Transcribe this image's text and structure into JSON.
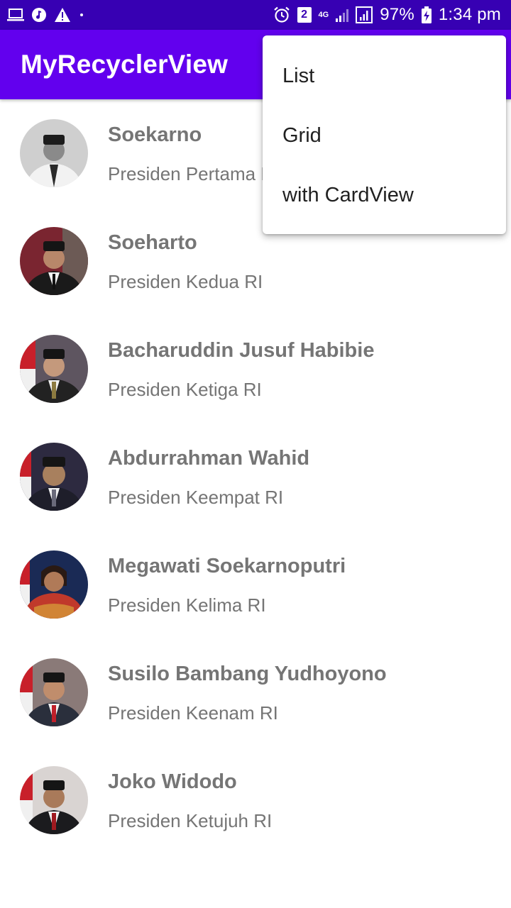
{
  "status_bar": {
    "left_icons": [
      "laptop-icon",
      "music-icon",
      "warning-icon",
      "dot-icon"
    ],
    "right_icons": [
      "alarm-icon",
      "sim-2-icon",
      "4g-data-icon",
      "signal-weak-icon",
      "signal-icon",
      "battery-charging-icon"
    ],
    "sim_label": "2",
    "network_label": "4G",
    "battery": "97%",
    "time": "1:34 pm"
  },
  "app_bar": {
    "title": "MyRecyclerView"
  },
  "menu": {
    "items": [
      {
        "label": "List"
      },
      {
        "label": "Grid"
      },
      {
        "label": "with CardView"
      }
    ]
  },
  "presidents": [
    {
      "name": "Soekarno",
      "description": "Presiden Pertama RI"
    },
    {
      "name": "Soeharto",
      "description": "Presiden Kedua RI"
    },
    {
      "name": "Bacharuddin Jusuf Habibie",
      "description": "Presiden Ketiga RI"
    },
    {
      "name": "Abdurrahman Wahid",
      "description": "Presiden Keempat RI"
    },
    {
      "name": "Megawati Soekarnoputri",
      "description": "Presiden Kelima RI"
    },
    {
      "name": "Susilo Bambang Yudhoyono",
      "description": "Presiden Keenam RI"
    },
    {
      "name": "Joko Widodo",
      "description": "Presiden Ketujuh RI"
    }
  ],
  "colors": {
    "status_bar": "#3700b3",
    "app_bar": "#6200ee",
    "list_text": "#757575",
    "menu_text": "#212121"
  }
}
